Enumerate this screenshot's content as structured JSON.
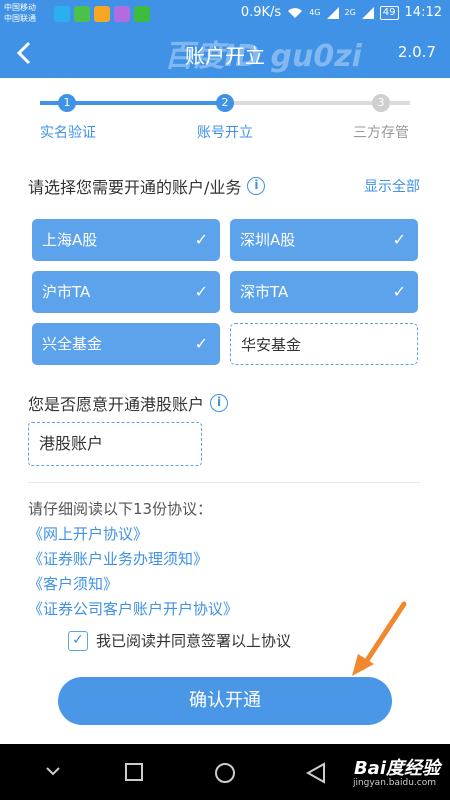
{
  "status_bar": {
    "carrier_1": "中国移动",
    "carrier_2": "中国联通",
    "app_icons": [
      "app-icon",
      "app-icon",
      "app-icon",
      "app-icon",
      "phone-icon"
    ],
    "speed": "0.9K/s",
    "network_1": "4G",
    "network_2": "2G",
    "battery": "49",
    "time": "14:12"
  },
  "nav": {
    "title": "账户开立",
    "version": "2.0.7",
    "watermark": "百度ID gu0zi"
  },
  "stepper": {
    "steps": [
      {
        "number": "1",
        "label": "实名验证",
        "state": "done"
      },
      {
        "number": "2",
        "label": "账号开立",
        "state": "active"
      },
      {
        "number": "3",
        "label": "三方存管",
        "state": "pending"
      }
    ]
  },
  "account_section": {
    "question": "请选择您需要开通的账户/业务",
    "info_icon": "i",
    "show_all": "显示全部",
    "options": [
      {
        "label": "上海A股",
        "selected": true
      },
      {
        "label": "深圳A股",
        "selected": true
      },
      {
        "label": "沪市TA",
        "selected": true
      },
      {
        "label": "深市TA",
        "selected": true
      },
      {
        "label": "兴全基金",
        "selected": true
      },
      {
        "label": "华安基金",
        "selected": false
      }
    ]
  },
  "hk_section": {
    "question": "您是否愿意开通港股账户",
    "info_icon": "i",
    "option": "港股账户"
  },
  "agreements": {
    "title": "请仔细阅读以下13份协议：",
    "links": [
      "《网上开户协议》",
      "《证券账户业务办理须知》",
      "《客户须知》",
      "《证券公司客户账户开户协议》"
    ]
  },
  "agree_checkbox": {
    "checked": true,
    "check_glyph": "✓",
    "label": "我已阅读并同意签署以上协议"
  },
  "confirm_button": {
    "label": "确认开通"
  },
  "system_nav": {
    "baidu_logo": "Bai度经验",
    "baidu_url": "jingyan.baidu.com"
  },
  "colors": {
    "primary": "#3f92e6",
    "option_selected": "#5ca3ec",
    "arrow": "#f0882e"
  }
}
